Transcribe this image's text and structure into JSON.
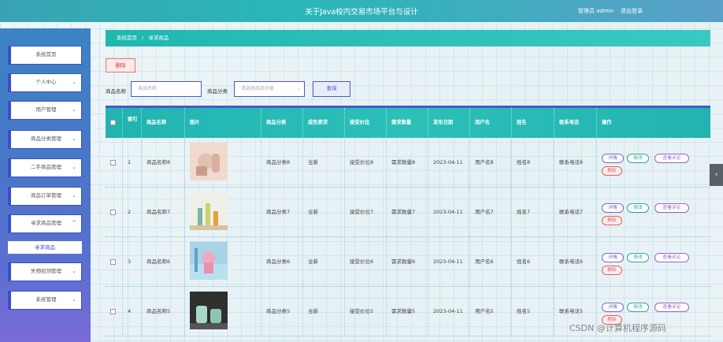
{
  "header": {
    "title": "关于Java校内交易市场平台与设计",
    "user_label": "管理员 admin",
    "logout_label": "退出登录"
  },
  "sidebar": {
    "items": [
      {
        "label": "系统首页",
        "chev": ""
      },
      {
        "label": "个人中心",
        "chev": "⌄"
      },
      {
        "label": "用户管理",
        "chev": "⌄"
      },
      {
        "label": "商品分类管理",
        "chev": "⌄"
      },
      {
        "label": "二手商品管理",
        "chev": "⌄"
      },
      {
        "label": "商品订单管理",
        "chev": "⌄"
      },
      {
        "label": "寻求商品管理",
        "chev": "^"
      },
      {
        "label": "失物招领管理",
        "chev": "⌄"
      },
      {
        "label": "系统管理",
        "chev": "⌄"
      }
    ],
    "submenu_label": "寻求商品"
  },
  "breadcrumb": {
    "home": "系统首页",
    "separator": "/",
    "current": "寻求商品"
  },
  "toolbar": {
    "delete_label": "删除",
    "name_label": "商品名称",
    "name_placeholder": "商品名称",
    "category_label": "商品分类",
    "category_placeholder": "请选择商品分类",
    "search_label": "查询"
  },
  "table": {
    "headers": {
      "index": "索引",
      "name": "商品名称",
      "image": "图片",
      "category": "商品分类",
      "condition": "成色要求",
      "price": "接受价位",
      "quantity": "需求数量",
      "date": "发布日期",
      "username": "用户名",
      "realname": "姓名",
      "phone": "联系电话",
      "actions": "操作"
    },
    "action_labels": {
      "detail": "详情",
      "edit": "修改",
      "comments": "查看评论",
      "delete": "删除"
    },
    "rows": [
      {
        "index": "1",
        "name": "商品名称8",
        "image": "ceramic-vases-photo",
        "category": "商品分类8",
        "condition": "全新",
        "price": "接受价位8",
        "quantity": "需求数量8",
        "date": "2023-04-11",
        "username": "用户名8",
        "realname": "姓名8",
        "phone": "联系电话8"
      },
      {
        "index": "2",
        "name": "商品名称7",
        "image": "bottles-photo",
        "category": "商品分类7",
        "condition": "全新",
        "price": "接受价位7",
        "quantity": "需求数量7",
        "date": "2023-04-11",
        "username": "用户名7",
        "realname": "姓名7",
        "phone": "联系电话7"
      },
      {
        "index": "3",
        "name": "商品名称6",
        "image": "figurine-photo",
        "category": "商品分类6",
        "condition": "全新",
        "price": "接受价位6",
        "quantity": "需求数量6",
        "date": "2023-04-11",
        "username": "用户名6",
        "realname": "姓名6",
        "phone": "联系电话6"
      },
      {
        "index": "4",
        "name": "商品名称5",
        "image": "tea-jars-photo",
        "category": "商品分类5",
        "condition": "全新",
        "price": "接受价位5",
        "quantity": "需求数量5",
        "date": "2023-04-11",
        "username": "用户名5",
        "realname": "姓名5",
        "phone": "联系电话5"
      }
    ]
  },
  "watermark": "CSDN @计算机程序源码",
  "side_arrow": "‹"
}
